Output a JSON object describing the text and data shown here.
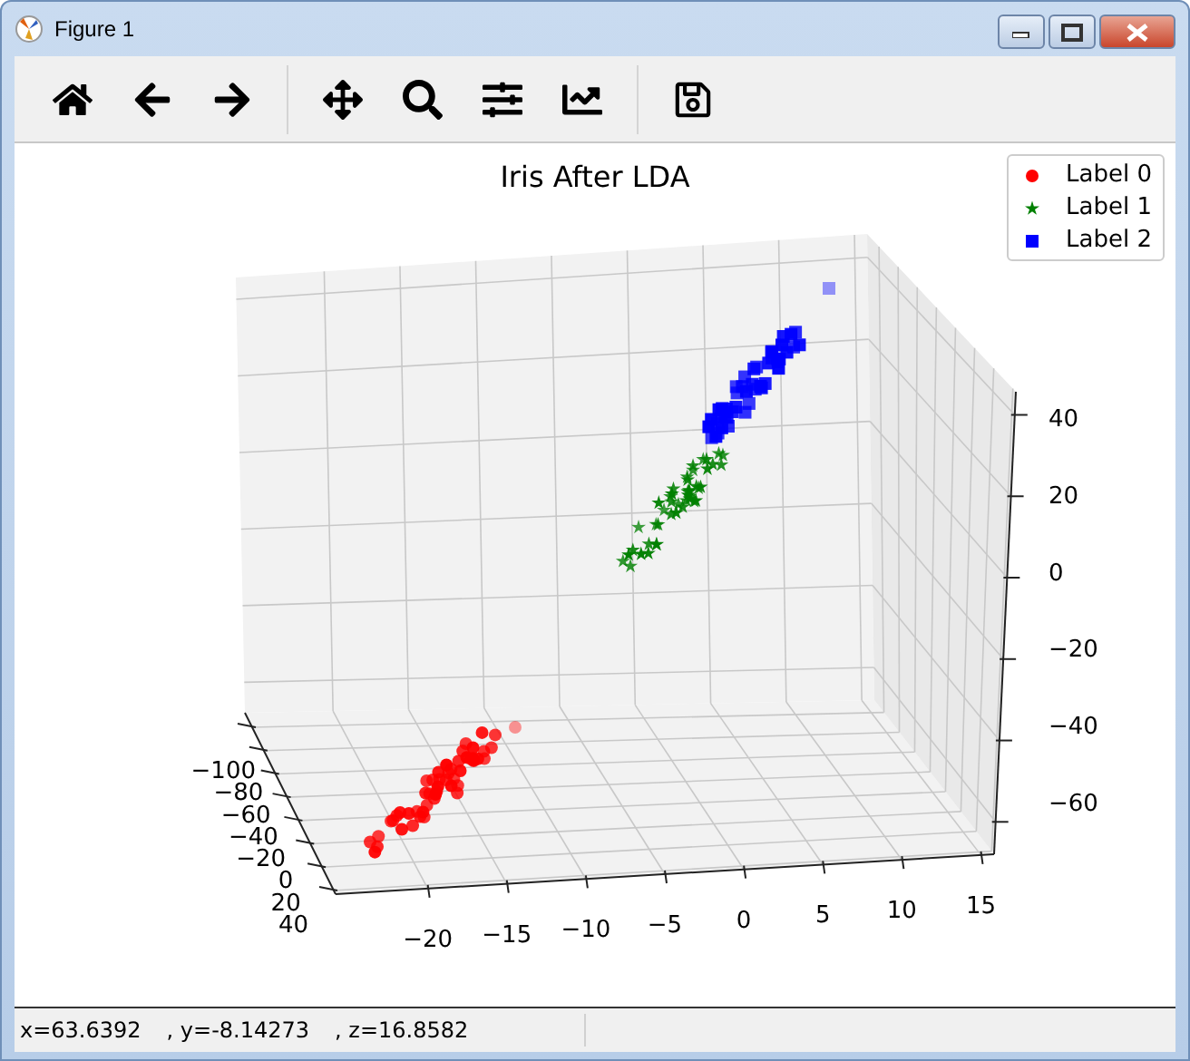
{
  "window": {
    "title": "Figure 1"
  },
  "plot": {
    "title": "Iris After LDA",
    "x_ticks": [
      "−20",
      "−15",
      "−10",
      "−5",
      "0",
      "5",
      "10",
      "15"
    ],
    "y_ticks": [
      "−100",
      "−80",
      "−60",
      "−40",
      "−20",
      "0",
      "20",
      "40"
    ],
    "z_ticks": [
      "40",
      "20",
      "0",
      "−20",
      "−40",
      "−60"
    ]
  },
  "legend": [
    {
      "label": "Label 0",
      "color": "#ff0000",
      "kind": "circle"
    },
    {
      "label": "Label 1",
      "color": "#008000",
      "kind": "star"
    },
    {
      "label": "Label 2",
      "color": "#0000ff",
      "kind": "square"
    }
  ],
  "status_bar": {
    "coordinates": [
      "x=63.6392",
      ", y=-8.14273",
      ", z=16.8582"
    ]
  }
}
